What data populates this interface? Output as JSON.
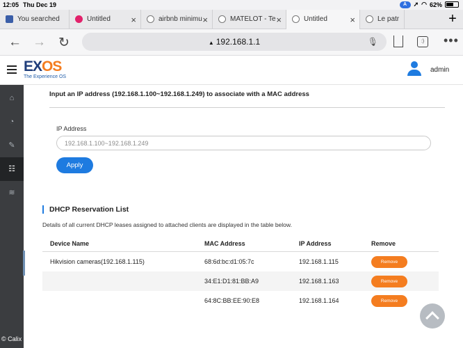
{
  "status_bar": {
    "time": "12:05",
    "date": "Thu Dec 19",
    "assistant_badge": "A",
    "battery_text": "62%"
  },
  "browser": {
    "tabs": [
      {
        "label": "You searched",
        "favicon": "doc"
      },
      {
        "label": "Untitled",
        "favicon": "pink"
      },
      {
        "label": "airbnb minimu",
        "favicon": "globe"
      },
      {
        "label": "MATELOT - Te",
        "favicon": "globe"
      },
      {
        "label": "Untitled",
        "favicon": "globe"
      },
      {
        "label": "Le patr",
        "favicon": "globe"
      }
    ],
    "new_tab_label": "+",
    "url": "192.168.1.1",
    "tabs_button_label": ":)"
  },
  "header": {
    "logo_main": "EX",
    "logo_accent": "OS",
    "logo_tagline": "The Experience OS",
    "username": "admin"
  },
  "footer_text": "© Calix I",
  "form": {
    "intro": "Input an IP address (192.168.1.100~192.168.1.249) to associate with a MAC address",
    "ip_label": "IP Address",
    "ip_value": "",
    "ip_placeholder": "192.168.1.100~192.168.1.249",
    "apply_label": "Apply"
  },
  "reservations": {
    "title": "DHCP Reservation List",
    "description": "Details of all current DHCP leases assigned to attached clients are displayed in the table below.",
    "columns": [
      "Device Name",
      "MAC Address",
      "IP Address",
      "Remove"
    ],
    "rows": [
      {
        "device": "Hikvision cameras(192.168.1.115)",
        "mac": "68:6d:bc:d1:05:7c",
        "ip": "192.168.1.115",
        "remove_label": "Remove"
      },
      {
        "device": "",
        "mac": "34:E1:D1:81:BB:A9",
        "ip": "192.168.1.163",
        "remove_label": "Remove"
      },
      {
        "device": "",
        "mac": "64:8C:BB:EE:90:E8",
        "ip": "192.168.1.164",
        "remove_label": "Remove"
      }
    ]
  },
  "colors": {
    "primary": "#1e7be0",
    "accent": "#f47d20",
    "sidebar": "#3b3d40"
  }
}
